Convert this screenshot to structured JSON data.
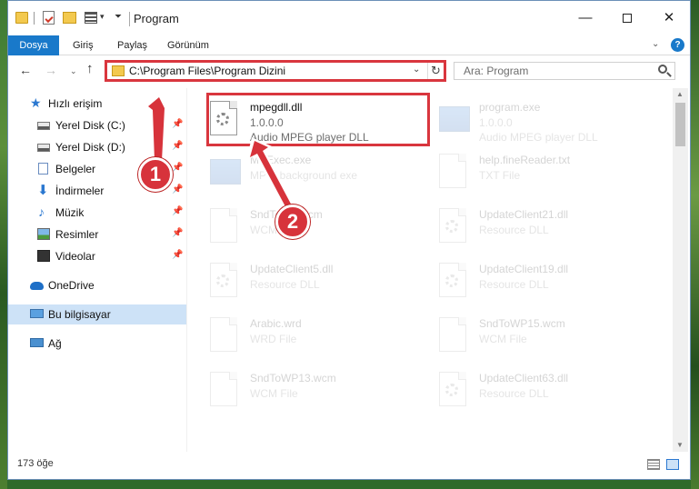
{
  "window": {
    "title": "Program",
    "min_glyph": "—",
    "close_glyph": "✕"
  },
  "ribbon": {
    "tabs": [
      "Dosya",
      "Giriş",
      "Paylaş",
      "Görünüm"
    ],
    "help": "?"
  },
  "nav": {
    "address": "C:\\Program Files\\Program Dizini",
    "search_placeholder": "Ara: Program"
  },
  "sidebar": {
    "items": [
      {
        "label": "Hızlı erişim",
        "icon": "star-icon"
      },
      {
        "label": "Yerel Disk (C:)",
        "icon": "drive-icon",
        "pinned": true
      },
      {
        "label": "Yerel Disk (D:)",
        "icon": "drive-icon",
        "pinned": true
      },
      {
        "label": "Belgeler",
        "icon": "documents-icon",
        "pinned": true
      },
      {
        "label": "İndirmeler",
        "icon": "download-icon",
        "pinned": true
      },
      {
        "label": "Müzik",
        "icon": "music-icon",
        "pinned": true
      },
      {
        "label": "Resimler",
        "icon": "pictures-icon",
        "pinned": true
      },
      {
        "label": "Videolar",
        "icon": "videos-icon",
        "pinned": true
      },
      {
        "label": "OneDrive",
        "icon": "cloud-icon"
      },
      {
        "label": "Bu bilgisayar",
        "icon": "computer-icon",
        "selected": true
      },
      {
        "label": "Ağ",
        "icon": "network-icon"
      }
    ]
  },
  "files": [
    {
      "name": "mpegdll.dll",
      "line1": "1.0.0.0",
      "line2": "Audio MPEG player DLL",
      "icon": "dll-file-icon",
      "highlighted": true
    },
    {
      "name": "program.exe",
      "line1": "1.0.0.0",
      "line2": "Audio MPEG player DLL",
      "icon": "exe-file-icon"
    },
    {
      "name": "MPExec.exe",
      "line1": "MPW background exe",
      "line2": "",
      "icon": "exe-file-icon"
    },
    {
      "name": "help.fineReader.txt",
      "line1": "TXT File",
      "line2": "",
      "icon": "text-file-icon"
    },
    {
      "name": "SndToWP.wcm",
      "line1": "WCM File",
      "line2": "",
      "icon": "generic-file-icon"
    },
    {
      "name": "UpdateClient21.dll",
      "line1": "Resource DLL",
      "line2": "",
      "icon": "dll-file-icon"
    },
    {
      "name": "UpdateClient5.dll",
      "line1": "Resource DLL",
      "line2": "",
      "icon": "dll-file-icon"
    },
    {
      "name": "UpdateClient19.dll",
      "line1": "Resource DLL",
      "line2": "",
      "icon": "dll-file-icon"
    },
    {
      "name": "Arabic.wrd",
      "line1": "WRD File",
      "line2": "",
      "icon": "generic-file-icon"
    },
    {
      "name": "SndToWP15.wcm",
      "line1": "WCM File",
      "line2": "",
      "icon": "generic-file-icon"
    },
    {
      "name": "SndToWP13.wcm",
      "line1": "WCM File",
      "line2": "",
      "icon": "generic-file-icon"
    },
    {
      "name": "UpdateClient63.dll",
      "line1": "Resource DLL",
      "line2": "",
      "icon": "dll-file-icon"
    }
  ],
  "annotations": {
    "step1": "1",
    "step2": "2"
  },
  "status": {
    "count": "173 öğe"
  },
  "colors": {
    "accent": "#1979ca",
    "highlight": "#d9363e",
    "selected_bg": "#cde2f7"
  }
}
